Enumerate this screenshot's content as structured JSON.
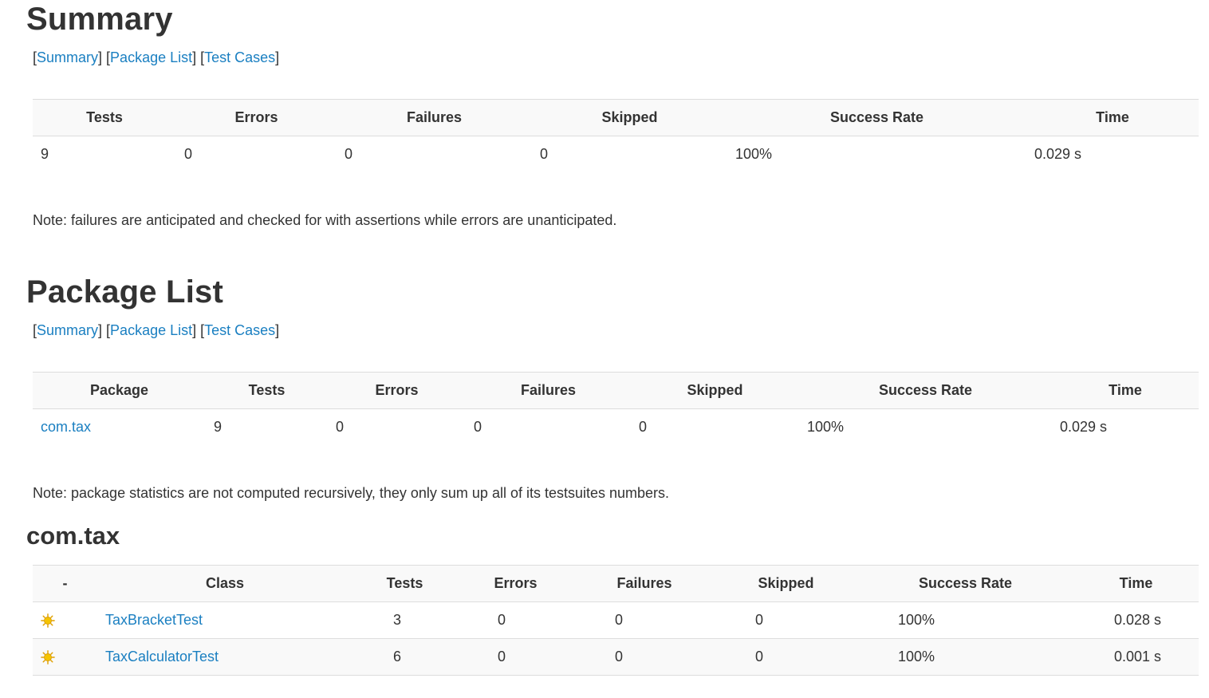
{
  "nav": {
    "open": "[",
    "sep": "] [",
    "close": "]",
    "summary": "Summary",
    "package_list": "Package List",
    "test_cases": "Test Cases"
  },
  "summary": {
    "title": "Summary",
    "headers": [
      "Tests",
      "Errors",
      "Failures",
      "Skipped",
      "Success Rate",
      "Time"
    ],
    "row": [
      "9",
      "0",
      "0",
      "0",
      "100%",
      "0.029 s"
    ],
    "note": "Note: failures are anticipated and checked for with assertions while errors are unanticipated."
  },
  "package_list": {
    "title": "Package List",
    "headers": [
      "Package",
      "Tests",
      "Errors",
      "Failures",
      "Skipped",
      "Success Rate",
      "Time"
    ],
    "row": [
      "com.tax",
      "9",
      "0",
      "0",
      "0",
      "100%",
      "0.029 s"
    ],
    "note": "Note: package statistics are not computed recursively, they only sum up all of its testsuites numbers."
  },
  "package": {
    "title": "com.tax",
    "headers": [
      "-",
      "Class",
      "Tests",
      "Errors",
      "Failures",
      "Skipped",
      "Success Rate",
      "Time"
    ],
    "rows": [
      {
        "icon": "success-sun-icon",
        "cells": [
          "TaxBracketTest",
          "3",
          "0",
          "0",
          "0",
          "100%",
          "0.028 s"
        ]
      },
      {
        "icon": "success-sun-icon",
        "cells": [
          "TaxCalculatorTest",
          "6",
          "0",
          "0",
          "0",
          "100%",
          "0.001 s"
        ]
      }
    ]
  },
  "colors": {
    "link": "#1a7fc1",
    "header_bg": "#f9f9f9",
    "border": "#dddddd",
    "text": "#333333",
    "sun": "#f5b700"
  }
}
